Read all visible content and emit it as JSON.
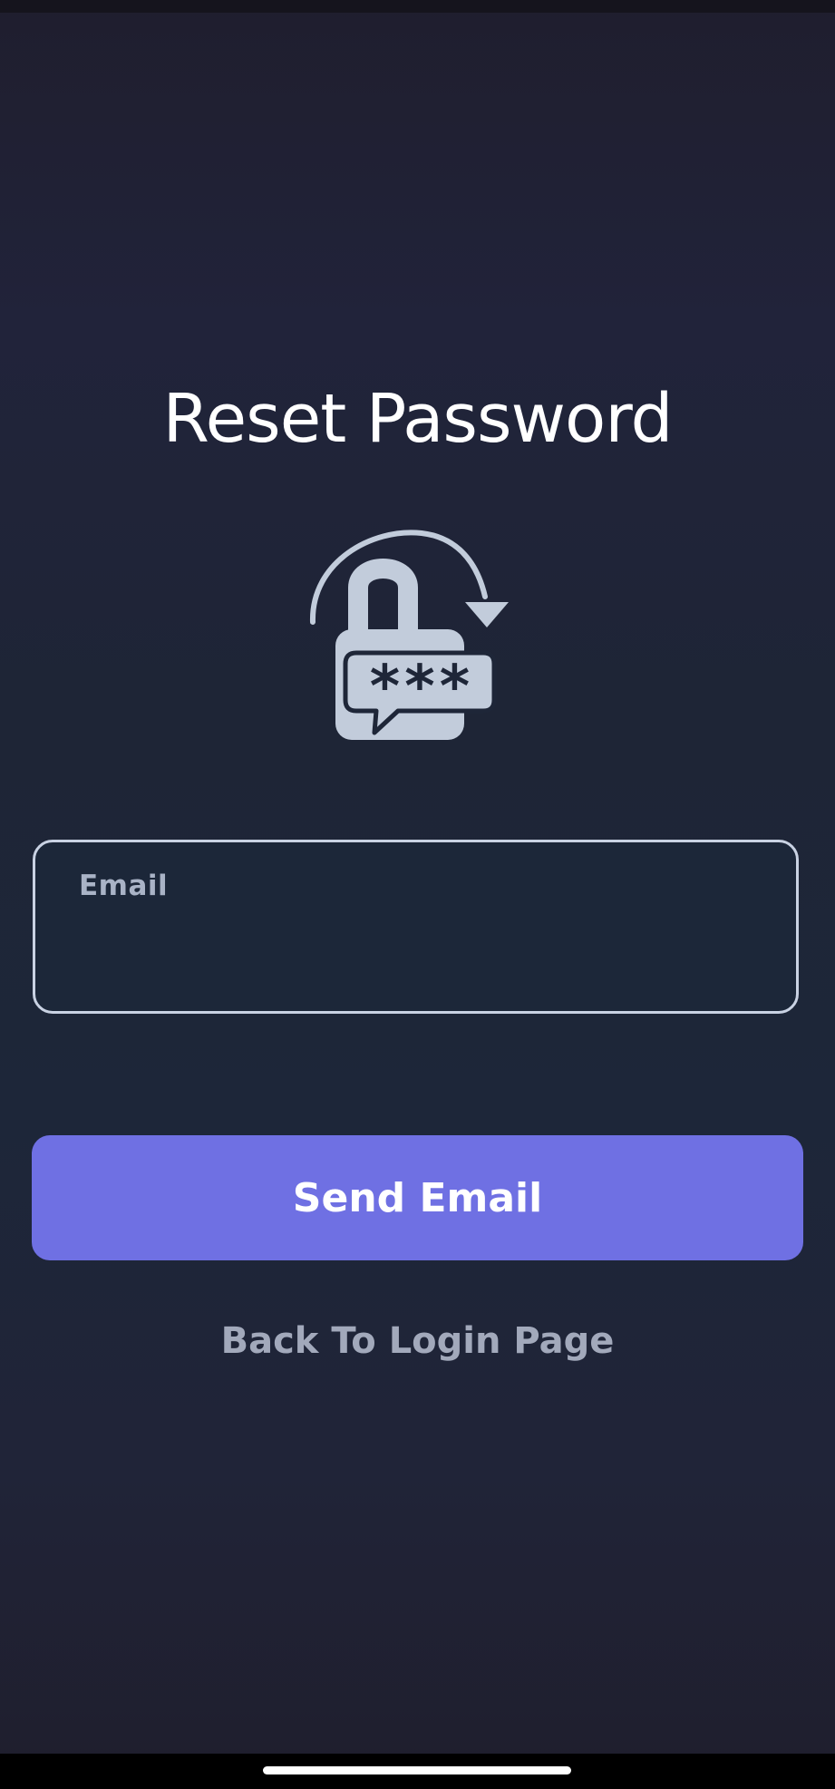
{
  "page": {
    "title": "Reset Password"
  },
  "illustration": {
    "icon": "lock-reset-icon",
    "masked_text": "***",
    "color": "#c2ccdb"
  },
  "form": {
    "email_label": "Email",
    "email_value": "",
    "send_button_label": "Send Email",
    "back_link_label": "Back To Login Page"
  },
  "colors": {
    "background": "#1e2536",
    "accent": "#6f70e3",
    "field_border": "#c9d2e3",
    "muted_text": "#a2a9bb"
  }
}
